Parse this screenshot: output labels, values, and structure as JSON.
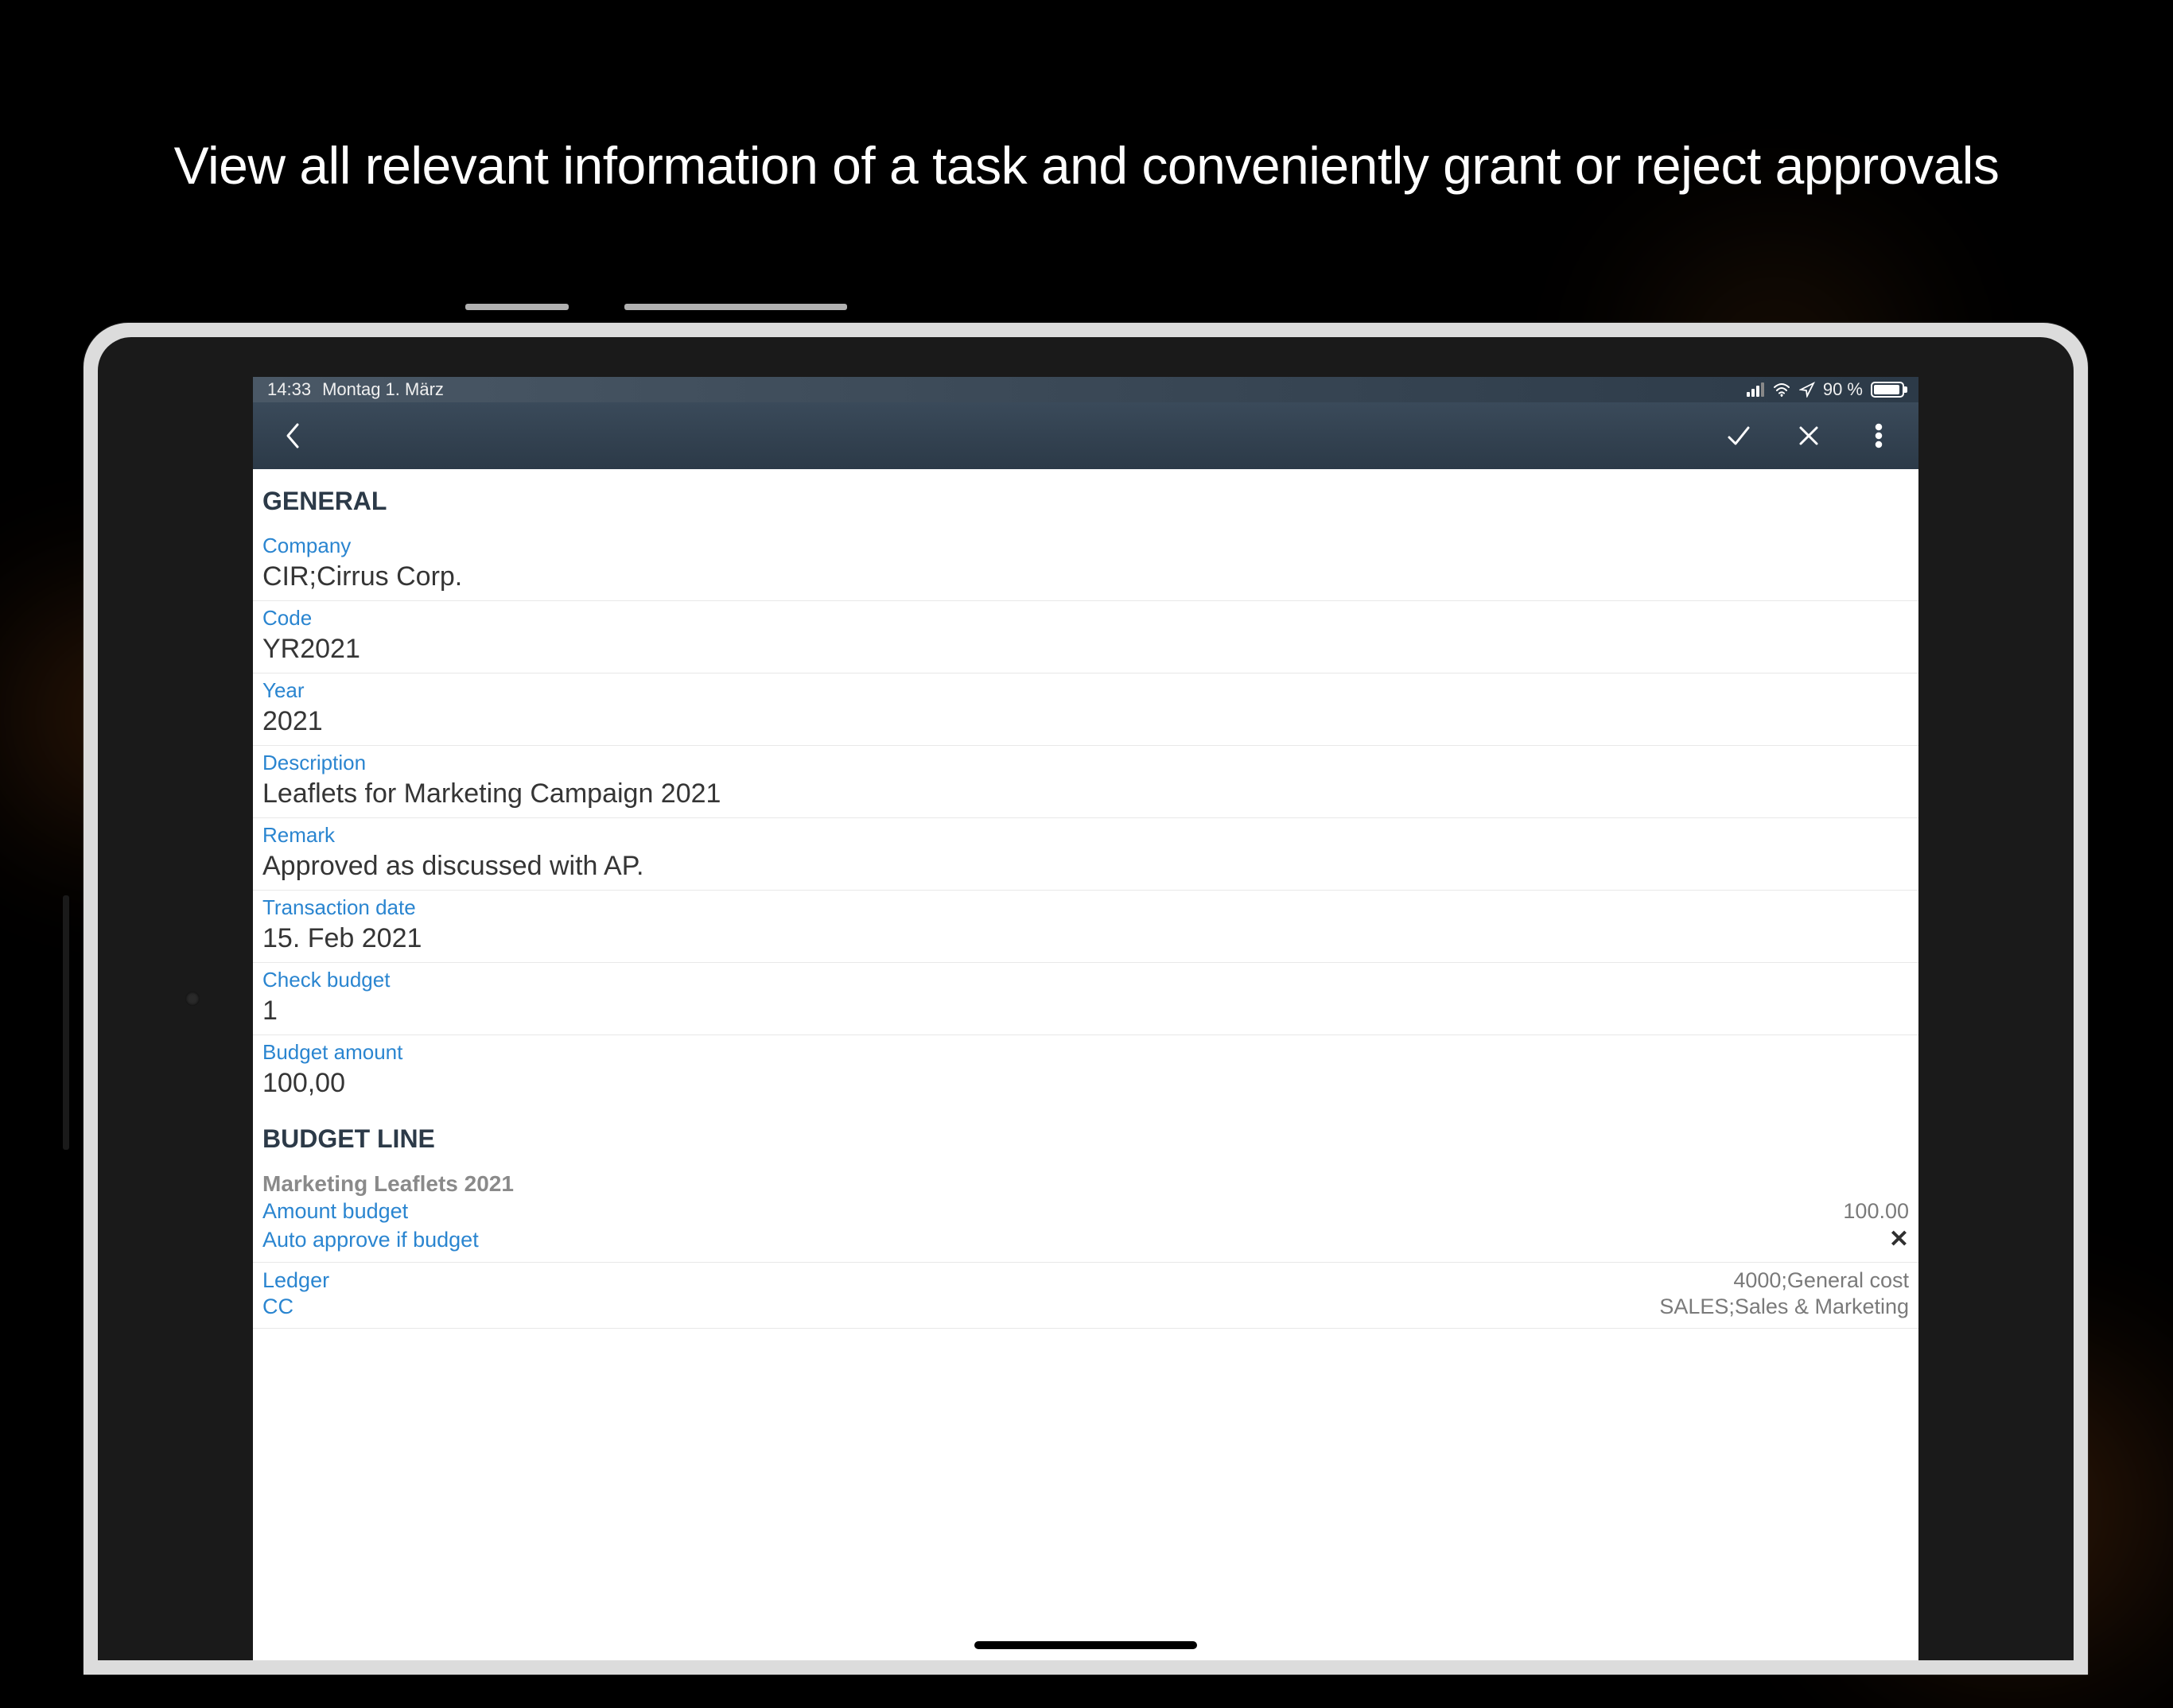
{
  "headline": "View all relevant information of a task and conveniently grant or reject approvals",
  "status": {
    "time": "14:33",
    "date": "Montag 1. März",
    "battery_pct": "90 %"
  },
  "sections": {
    "general": {
      "title": "GENERAL",
      "company_label": "Company",
      "company_value": "CIR;Cirrus Corp.",
      "code_label": "Code",
      "code_value": "YR2021",
      "year_label": "Year",
      "year_value": "2021",
      "description_label": "Description",
      "description_value": "Leaflets for Marketing Campaign 2021",
      "remark_label": "Remark",
      "remark_value": "Approved as discussed with AP.",
      "transaction_date_label": "Transaction date",
      "transaction_date_value": "15. Feb 2021",
      "check_budget_label": "Check budget",
      "check_budget_value": "1",
      "budget_amount_label": "Budget amount",
      "budget_amount_value": "100,00"
    },
    "budget_line": {
      "title": "BUDGET LINE",
      "item_title": "Marketing Leaflets 2021",
      "amount_budget_label": "Amount budget",
      "amount_budget_value": "100.00",
      "auto_approve_label": "Auto approve if budget",
      "ledger_label": "Ledger",
      "ledger_value": "4000;General cost",
      "cc_label": "CC",
      "cc_value": "SALES;Sales & Marketing"
    }
  }
}
